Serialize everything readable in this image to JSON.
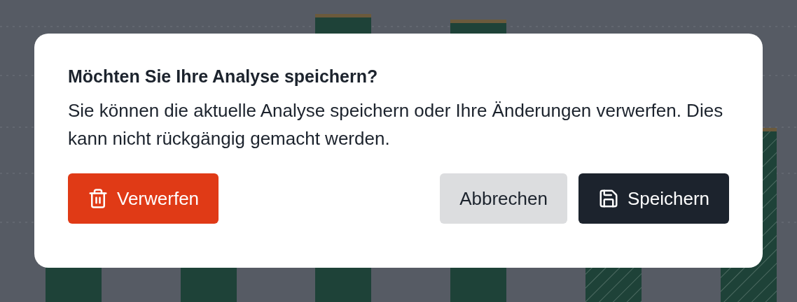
{
  "dialog": {
    "title": "Möchten Sie Ihre Analyse speichern?",
    "message": "Sie können die aktuelle Analyse speichern oder Ihre Änderungen verwerfen. Dies kann nicht rückgängig gemacht werden.",
    "buttons": [
      {
        "kind": "danger",
        "label": "Verwerfen"
      },
      {
        "kind": "secondary",
        "label": "Abbrechen"
      },
      {
        "kind": "primary",
        "label": "Speichern"
      }
    ]
  }
}
